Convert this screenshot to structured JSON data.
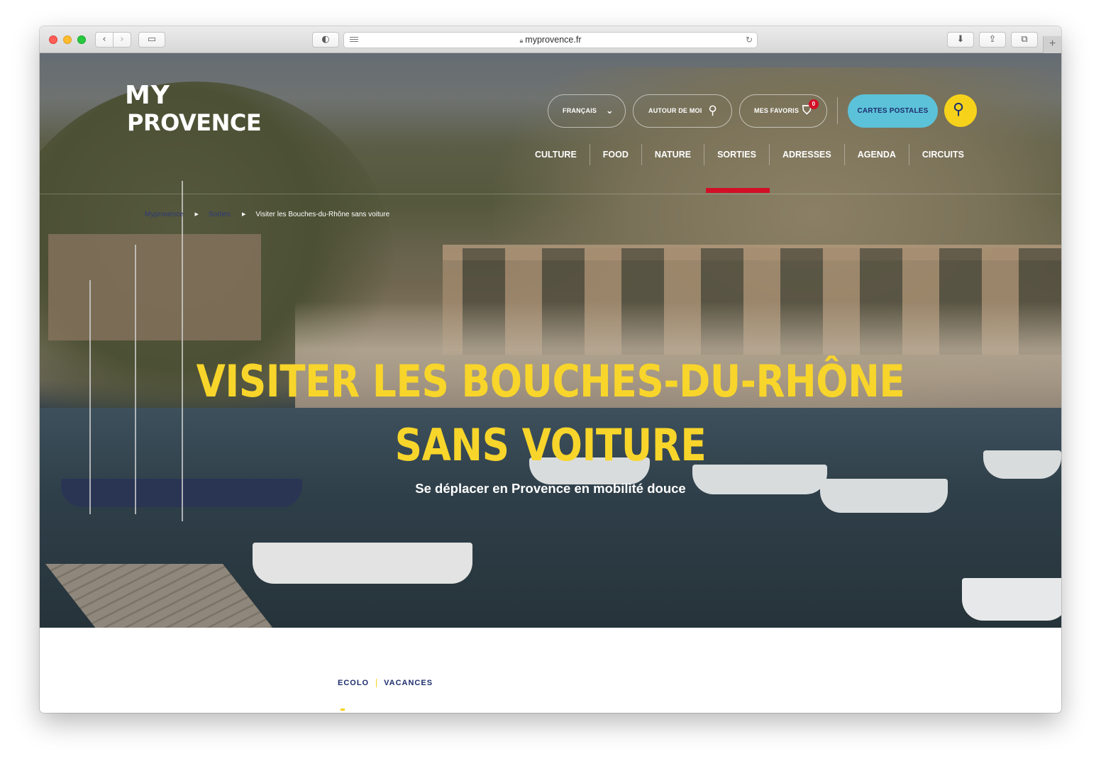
{
  "browser": {
    "url": "myprovence.fr",
    "lock_icon": "lock-icon",
    "reload_icon": "reload-icon",
    "back_icon": "chevron-left-icon",
    "forward_icon": "chevron-right-icon",
    "new_tab_label": "+"
  },
  "site": {
    "logo_top": "MY",
    "logo_bottom": "PROVENCE",
    "language_label": "FRANÇAIS",
    "near_me_label": "AUTOUR DE MOI",
    "favorites_label": "MES FAVORIS",
    "favorites_count": "0",
    "postcards_label": "CARTES POSTALES",
    "accent_yellow": "#f7d21b",
    "accent_red": "#d20f27",
    "accent_cyan": "#5cc2d9",
    "navy": "#1d2e6d"
  },
  "nav": {
    "items": [
      "CULTURE",
      "FOOD",
      "NATURE",
      "SORTIES",
      "ADRESSES",
      "AGENDA",
      "CIRCUITS"
    ],
    "active": "SORTIES"
  },
  "breadcrumb": {
    "home": "Myprovence",
    "section": "Sorties",
    "current": "Visiter les Bouches-du-Rhône sans voiture"
  },
  "hero": {
    "title_line1": "Visiter les Bouches-du-Rhône",
    "title_line2": "sans voiture",
    "subtitle": "Se déplacer en Provence en mobilité douce"
  },
  "tags": [
    "ECOLO",
    "VACANCES"
  ]
}
